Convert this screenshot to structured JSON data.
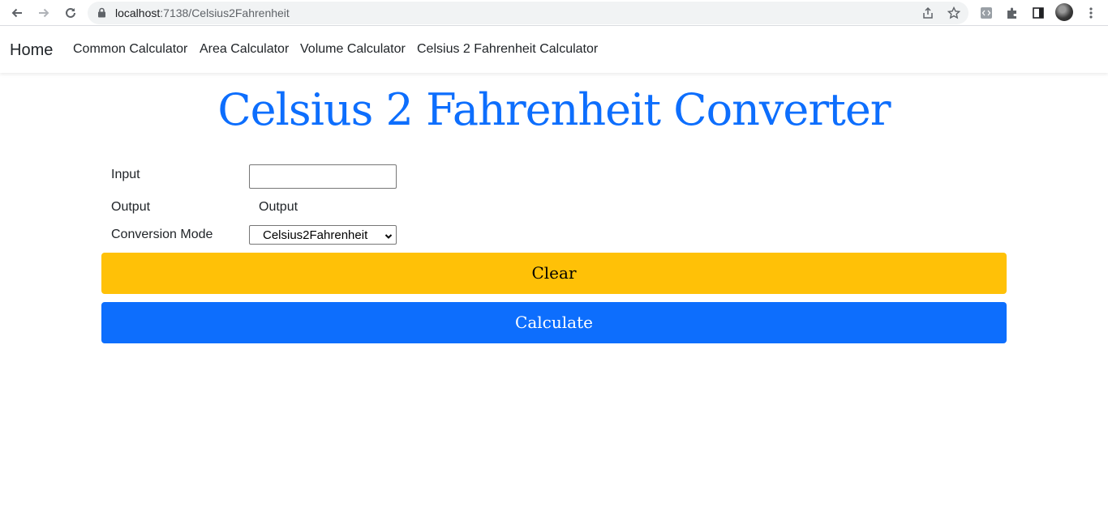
{
  "browser": {
    "url_host": "localhost",
    "url_path": ":7138/Celsius2Fahrenheit"
  },
  "navbar": {
    "brand": "Home",
    "links": [
      "Common Calculator",
      "Area Calculator",
      "Volume Calculator",
      "Celsius 2 Fahrenheit Calculator"
    ]
  },
  "page": {
    "title": "Celsius 2 Fahrenheit Converter",
    "input_label": "Input",
    "input_value": "",
    "output_label": "Output",
    "output_value": "Output",
    "mode_label": "Conversion Mode",
    "mode_selected": "Celsius2Fahrenheit",
    "clear_label": "Clear",
    "calculate_label": "Calculate"
  },
  "colors": {
    "primary": "#0d6efd",
    "warning": "#ffc107"
  }
}
